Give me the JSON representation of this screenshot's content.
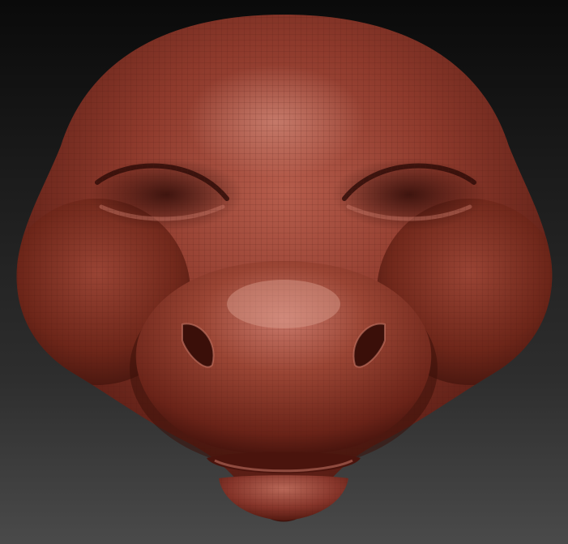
{
  "scene": {
    "subject_icon": "pig-head-sculpt",
    "colors": {
      "background_top": "#0a0a0a",
      "background_bottom": "#4a4a4a",
      "clay_base": "#8a3326",
      "clay_highlight": "#c06a5a",
      "clay_shadow": "#4a1510",
      "wireframe": "#5a2018"
    }
  }
}
